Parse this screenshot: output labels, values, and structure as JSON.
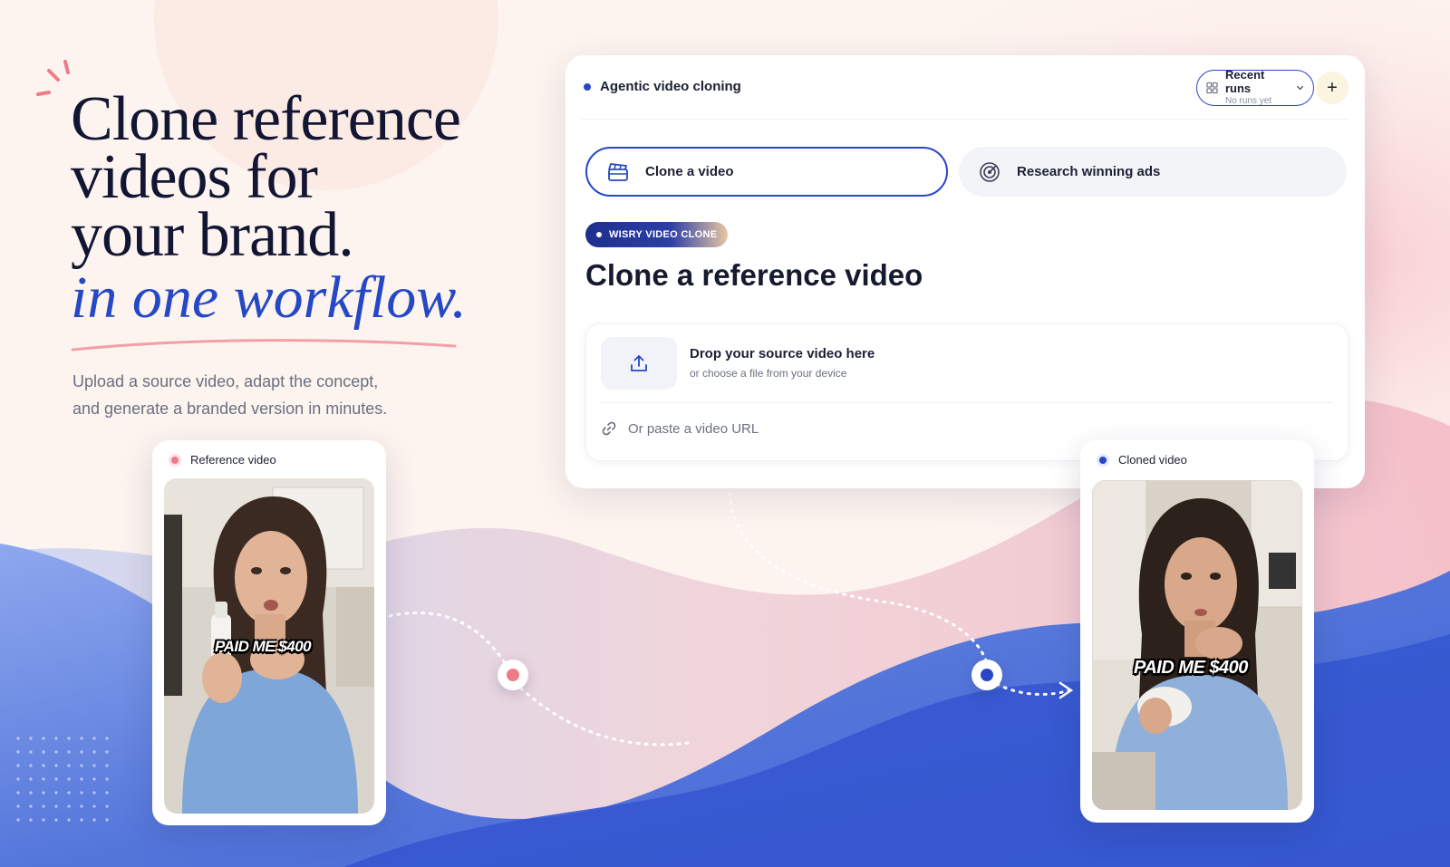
{
  "hero": {
    "line1": "Clone reference",
    "line2": "videos for",
    "line3": "your brand.",
    "accent": "in one workflow.",
    "subtitle_line1": "Upload a source video, adapt the concept,",
    "subtitle_line2": "and generate a branded version in minutes."
  },
  "card": {
    "title": "Agentic video cloning",
    "recent_runs": {
      "label": "Recent runs",
      "sublabel": "No runs yet"
    },
    "add_button": "+",
    "tabs": [
      {
        "label": "Clone a video",
        "icon": "clapperboard-icon",
        "active": true
      },
      {
        "label": "Research winning ads",
        "icon": "radar-icon",
        "active": false
      }
    ],
    "badge": "WISRY VIDEO CLONE",
    "heading": "Clone a reference video",
    "dropzone": {
      "title": "Drop your source video here",
      "subtitle": "or choose a file from your device",
      "url_label": "Or paste a video URL"
    }
  },
  "reference": {
    "label": "Reference video",
    "caption": "PAID ME $400"
  },
  "cloned": {
    "label": "Cloned video",
    "caption": "PAID ME $400"
  },
  "colors": {
    "accent": "#2746c8",
    "pink": "#ef7b88",
    "headline": "#121633",
    "background": "#fdf3ee"
  }
}
